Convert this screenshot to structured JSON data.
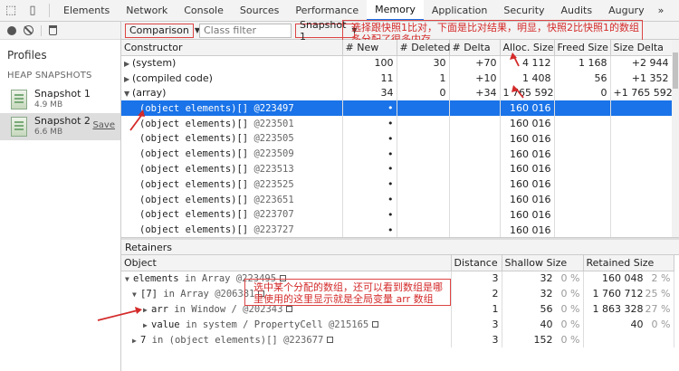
{
  "tabs": [
    {
      "label": "Elements"
    },
    {
      "label": "Network"
    },
    {
      "label": "Console"
    },
    {
      "label": "Sources"
    },
    {
      "label": "Performance"
    },
    {
      "label": "Memory",
      "active": true
    },
    {
      "label": "Application"
    },
    {
      "label": "Security"
    },
    {
      "label": "Audits"
    },
    {
      "label": "Augury"
    }
  ],
  "more_tabs": "»",
  "sidebar": {
    "title": "Profiles",
    "section": "HEAP SNAPSHOTS",
    "snapshots": [
      {
        "name": "Snapshot 1",
        "size": "4.9 MB"
      },
      {
        "name": "Snapshot 2",
        "size": "6.6 MB",
        "save": "Save"
      }
    ]
  },
  "filter": {
    "view": "Comparison",
    "class_filter_placeholder": "Class filter",
    "base": "Snapshot 1"
  },
  "annotations": {
    "top": "选择跟快照1比对，下面是比对结果，明显，快照2比快照1的数组多分配了很多内存",
    "retainer": "选中某个分配的数组，还可以看到数组是哪里使用的这里显示就是全局变量 arr 数组"
  },
  "upper": {
    "headers": [
      "Constructor",
      "# New",
      "# Deleted",
      "# Delta",
      "Alloc. Size",
      "Freed Size",
      "Size Delta"
    ],
    "rows": [
      {
        "name": "(system)",
        "tri": "▶",
        "new": "100",
        "deleted": "30",
        "delta": "+70",
        "alloc": "4 112",
        "freed": "1 168",
        "sdelta": "+2 944"
      },
      {
        "name": "(compiled code)",
        "tri": "▶",
        "new": "11",
        "deleted": "1",
        "delta": "+10",
        "alloc": "1 408",
        "freed": "56",
        "sdelta": "+1 352"
      },
      {
        "name": "(array)",
        "tri": "▼",
        "new": "34",
        "deleted": "0",
        "delta": "+34",
        "alloc": "1 765 592",
        "freed": "0",
        "sdelta": "+1 765 592"
      }
    ],
    "children": [
      {
        "label": "(object elements)[]",
        "addr": "@223497",
        "mark": "•",
        "alloc": "160 016",
        "selected": true
      },
      {
        "label": "(object elements)[]",
        "addr": "@223501",
        "mark": "•",
        "alloc": "160 016"
      },
      {
        "label": "(object elements)[]",
        "addr": "@223505",
        "mark": "•",
        "alloc": "160 016"
      },
      {
        "label": "(object elements)[]",
        "addr": "@223509",
        "mark": "•",
        "alloc": "160 016"
      },
      {
        "label": "(object elements)[]",
        "addr": "@223513",
        "mark": "•",
        "alloc": "160 016"
      },
      {
        "label": "(object elements)[]",
        "addr": "@223525",
        "mark": "•",
        "alloc": "160 016"
      },
      {
        "label": "(object elements)[]",
        "addr": "@223651",
        "mark": "•",
        "alloc": "160 016"
      },
      {
        "label": "(object elements)[]",
        "addr": "@223707",
        "mark": "•",
        "alloc": "160 016"
      },
      {
        "label": "(object elements)[]",
        "addr": "@223727",
        "mark": "•",
        "alloc": "160 016"
      }
    ]
  },
  "retainers": {
    "title": "Retainers",
    "headers": [
      "Object",
      "Distance",
      "Shallow Size",
      "Retained Size"
    ],
    "rows": [
      {
        "tri": "▼",
        "prefix": "elements",
        "mid": "in Array",
        "addr": "@223495",
        "distance": "3",
        "shallow": "32",
        "shallow_pct": "0 %",
        "retained": "160 048",
        "retained_pct": "2 %"
      },
      {
        "tri": "▼",
        "prefix": "[7]",
        "mid": "in Array",
        "addr": "@206381",
        "distance": "2",
        "shallow": "32",
        "shallow_pct": "0 %",
        "retained": "1 760 712",
        "retained_pct": "25 %"
      },
      {
        "tri": "▶",
        "prefix": "arr",
        "mid": "in Window /",
        "addr": "@202343",
        "distance": "1",
        "shallow": "56",
        "shallow_pct": "0 %",
        "retained": "1 863 328",
        "retained_pct": "27 %"
      },
      {
        "tri": "▶",
        "prefix": "value",
        "mid": "in system / PropertyCell",
        "addr": "@215165",
        "distance": "3",
        "shallow": "40",
        "shallow_pct": "0 %",
        "retained": "40",
        "retained_pct": "0 %"
      },
      {
        "tri": "▶",
        "prefix": "7",
        "mid": "in (object elements)[]",
        "addr": "@223677",
        "distance": "3",
        "shallow": "152",
        "shallow_pct": "0 %",
        "retained": "",
        "retained_pct": ""
      }
    ]
  }
}
